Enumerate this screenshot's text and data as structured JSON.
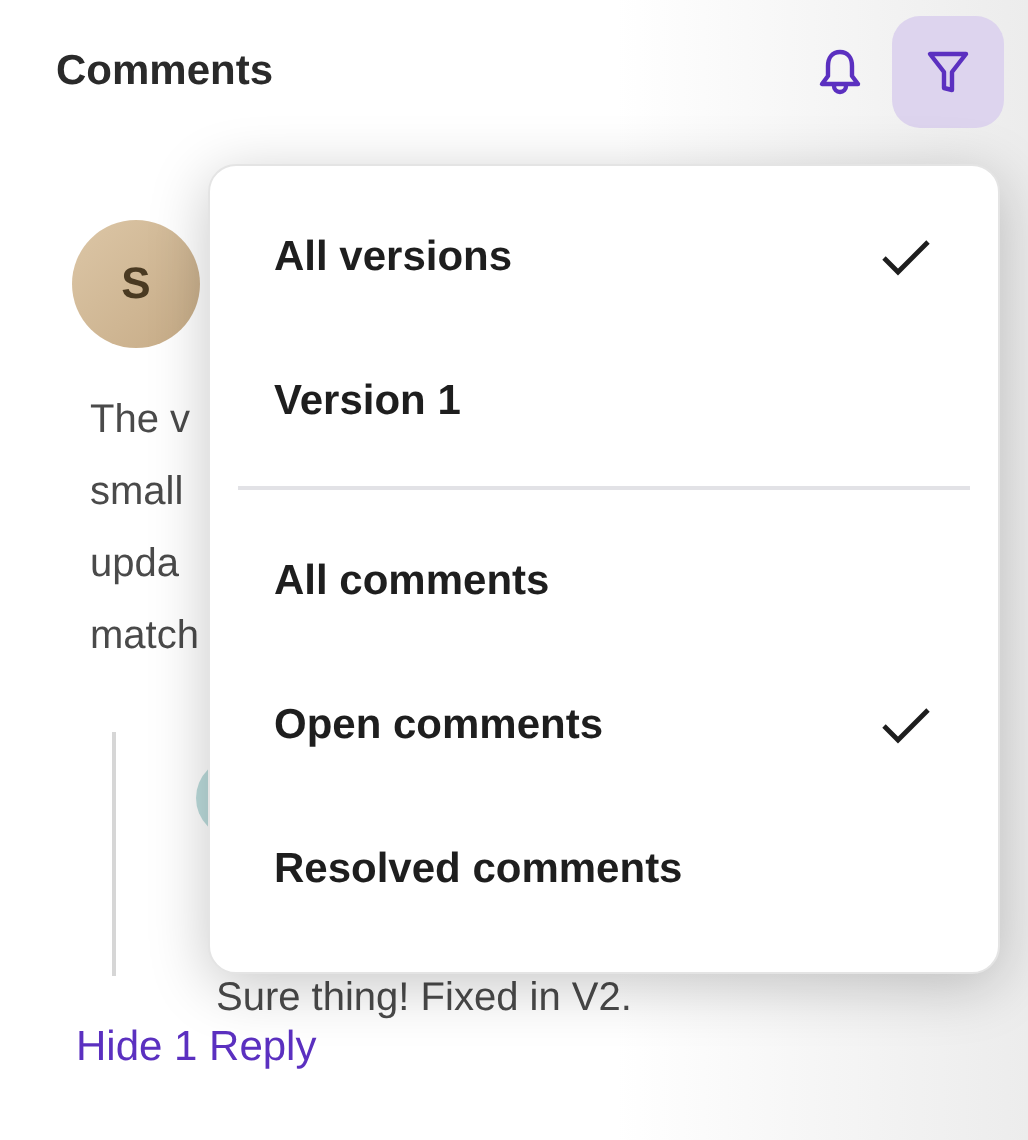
{
  "header": {
    "title": "Comments"
  },
  "comment": {
    "avatar": "S",
    "lines": [
      "The v",
      "small",
      "upda",
      "match"
    ],
    "reply": {
      "text": "Sure thing! Fixed in V2."
    },
    "toggle": "Hide 1 Reply"
  },
  "filter_menu": {
    "open": true,
    "groups": [
      [
        {
          "label": "All versions",
          "selected": true
        },
        {
          "label": "Version 1",
          "selected": false
        }
      ],
      [
        {
          "label": "All comments",
          "selected": false
        },
        {
          "label": "Open comments",
          "selected": true
        },
        {
          "label": "Resolved comments",
          "selected": false
        }
      ]
    ]
  }
}
